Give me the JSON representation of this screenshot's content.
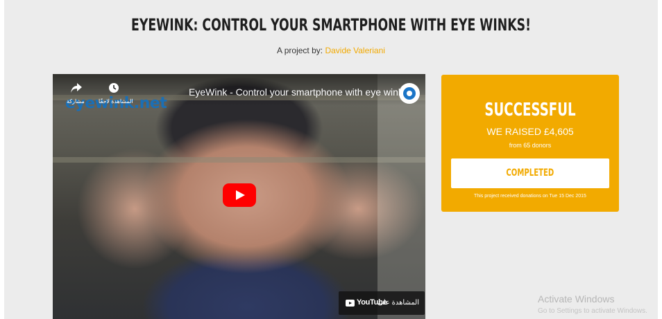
{
  "project": {
    "title": "EYEWINK: CONTROL YOUR SMARTPHONE WITH EYE WINKS!",
    "byline_prefix": "A project by:",
    "author": "Davide Valeriani"
  },
  "video": {
    "title": "EyeWink - Control your smartphone with eye winks",
    "share_label": "مشاركة",
    "watch_later_label": "المشاهدة لاحقًا",
    "watermark": "eyewink.net",
    "watch_on": "المشاهدة على",
    "youtube_label": "YouTube",
    "share_icon": "share-icon",
    "clock_icon": "clock-icon",
    "play_icon": "play-icon"
  },
  "card": {
    "status": "SUCCESSFUL",
    "raised": "WE RAISED £4,605",
    "donors": "from 65 donors",
    "button": "COMPLETED",
    "note": "This project received donations on Tue 15 Dec 2015",
    "color": "#f2aa00"
  },
  "os_watermark": {
    "line1": "Activate Windows",
    "line2": "Go to Settings to activate Windows."
  }
}
